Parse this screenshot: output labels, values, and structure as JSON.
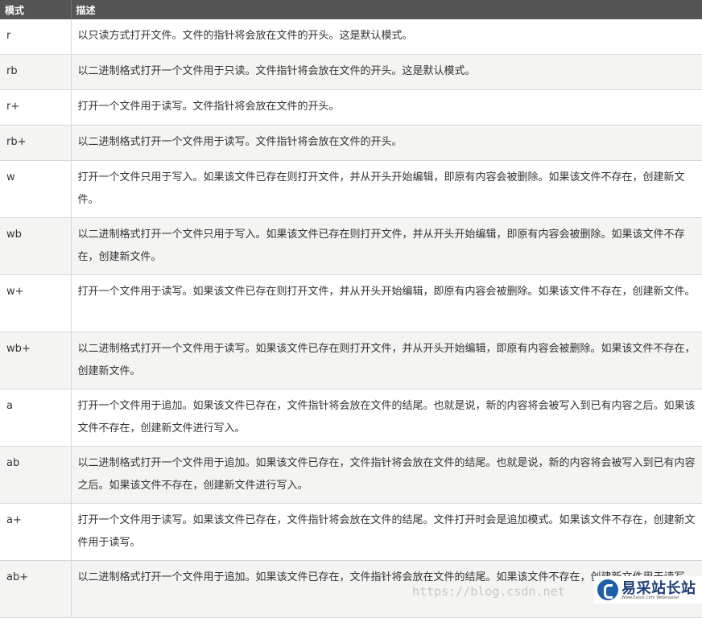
{
  "table": {
    "headers": {
      "mode": "模式",
      "description": "描述"
    },
    "rows": [
      {
        "mode": "r",
        "description": "以只读方式打开文件。文件的指针将会放在文件的开头。这是默认模式。"
      },
      {
        "mode": "rb",
        "description": "以二进制格式打开一个文件用于只读。文件指针将会放在文件的开头。这是默认模式。"
      },
      {
        "mode": "r+",
        "description": "打开一个文件用于读写。文件指针将会放在文件的开头。"
      },
      {
        "mode": "rb+",
        "description": "以二进制格式打开一个文件用于读写。文件指针将会放在文件的开头。"
      },
      {
        "mode": "w",
        "description": "打开一个文件只用于写入。如果该文件已存在则打开文件，并从开头开始编辑，即原有内容会被删除。如果该文件不存在，创建新文件。"
      },
      {
        "mode": "wb",
        "description": "以二进制格式打开一个文件只用于写入。如果该文件已存在则打开文件，并从开头开始编辑，即原有内容会被删除。如果该文件不存在，创建新文件。"
      },
      {
        "mode": "w+",
        "description": "打开一个文件用于读写。如果该文件已存在则打开文件，并从开头开始编辑，即原有内容会被删除。如果该文件不存在，创建新文件。"
      },
      {
        "mode": "wb+",
        "description": "以二进制格式打开一个文件用于读写。如果该文件已存在则打开文件，并从开头开始编辑，即原有内容会被删除。如果该文件不存在，创建新文件。"
      },
      {
        "mode": "a",
        "description": "打开一个文件用于追加。如果该文件已存在，文件指针将会放在文件的结尾。也就是说，新的内容将会被写入到已有内容之后。如果该文件不存在，创建新文件进行写入。"
      },
      {
        "mode": "ab",
        "description": "以二进制格式打开一个文件用于追加。如果该文件已存在，文件指针将会放在文件的结尾。也就是说，新的内容将会被写入到已有内容之后。如果该文件不存在，创建新文件进行写入。"
      },
      {
        "mode": "a+",
        "description": "打开一个文件用于读写。如果该文件已存在，文件指针将会放在文件的结尾。文件打开时会是追加模式。如果该文件不存在，创建新文件用于读写。"
      },
      {
        "mode": "ab+",
        "description": "以二进制格式打开一个文件用于追加。如果该文件已存在，文件指针将会放在文件的结尾。如果该文件不存在，创建新文件用于读写。"
      }
    ]
  },
  "watermark": "https://blog.csdn.net",
  "logo": {
    "brand": "易采站长站",
    "sub": "Www.Easck.Com Webmaster"
  }
}
